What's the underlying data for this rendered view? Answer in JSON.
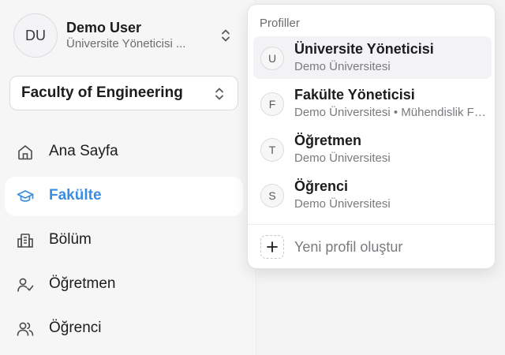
{
  "user": {
    "initials": "DU",
    "name": "Demo User",
    "role": "Üniversite Yöneticisi ..."
  },
  "faculty_selector": {
    "label": "Faculty of Engineering"
  },
  "nav": {
    "items": [
      {
        "label": "Ana Sayfa",
        "icon": "home-icon",
        "active": false
      },
      {
        "label": "Fakülte",
        "icon": "graduation-cap-icon",
        "active": true
      },
      {
        "label": "Bölüm",
        "icon": "building-icon",
        "active": false
      },
      {
        "label": "Öğretmen",
        "icon": "user-check-icon",
        "active": false
      },
      {
        "label": "Öğrenci",
        "icon": "users-icon",
        "active": false
      }
    ]
  },
  "profiles_menu": {
    "title": "Profiller",
    "profiles": [
      {
        "initial": "U",
        "name": "Üniversite Yöneticisi",
        "subtitle": "Demo Üniversitesi",
        "selected": true
      },
      {
        "initial": "F",
        "name": "Fakülte Yöneticisi",
        "subtitle": "Demo Üniversitesi • Mühendislik Fakültesi",
        "selected": false
      },
      {
        "initial": "T",
        "name": "Öğretmen",
        "subtitle": "Demo Üniversitesi",
        "selected": false
      },
      {
        "initial": "S",
        "name": "Öğrenci",
        "subtitle": "Demo Üniversitesi",
        "selected": false
      }
    ],
    "new_profile_label": "Yeni profil oluştur"
  },
  "colors": {
    "accent": "#3b8de0",
    "text": "#1c1c1e",
    "muted": "#7a7a7f"
  }
}
